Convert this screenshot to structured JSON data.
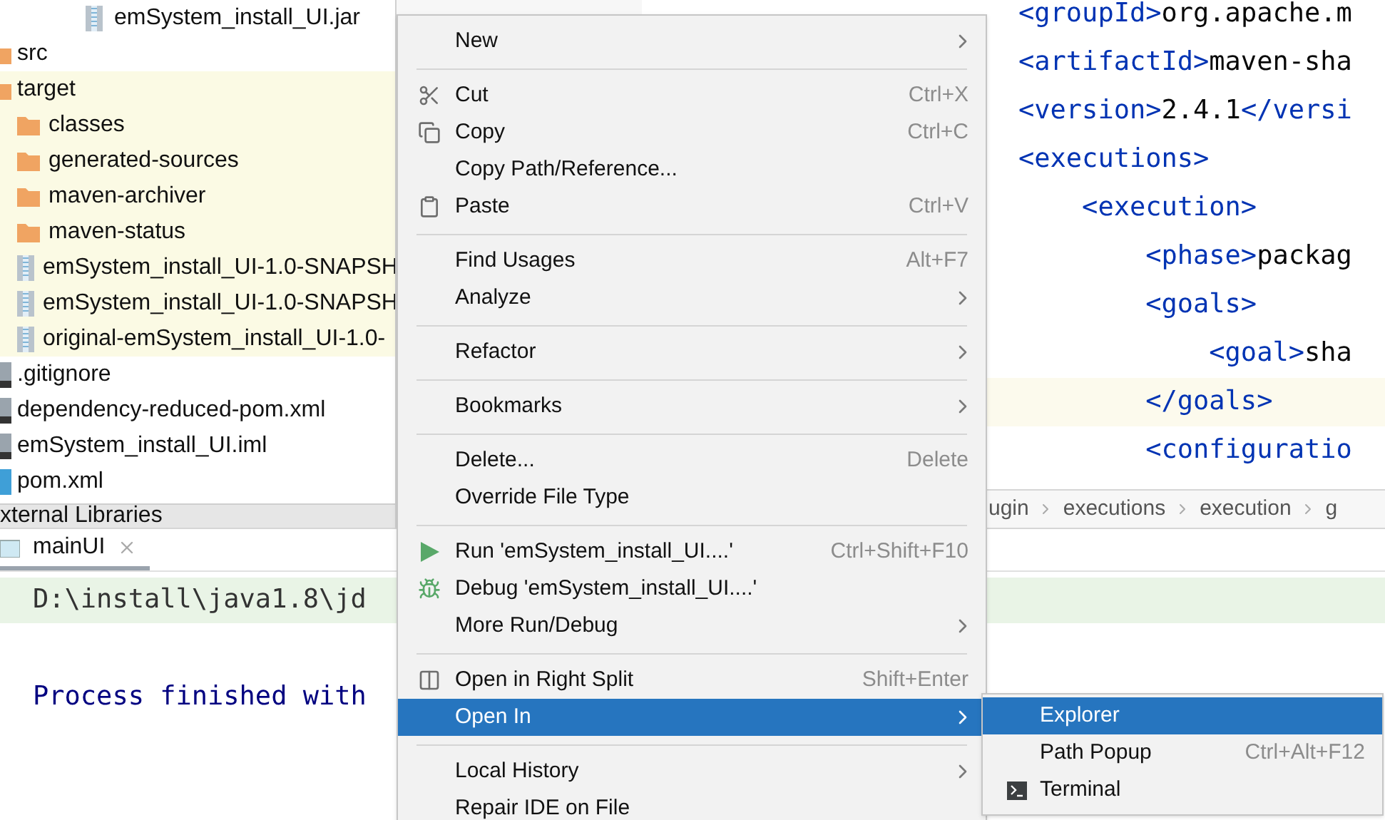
{
  "project_tree": {
    "header_item": {
      "label": "emSystem_install_UI.jar"
    },
    "items": [
      {
        "label": "src",
        "kind": "folder",
        "excluded": false
      },
      {
        "label": "target",
        "kind": "folder",
        "excluded": true,
        "children": [
          {
            "label": "classes",
            "kind": "folder",
            "excluded": true
          },
          {
            "label": "generated-sources",
            "kind": "folder",
            "excluded": true
          },
          {
            "label": "maven-archiver",
            "kind": "folder",
            "excluded": true
          },
          {
            "label": "maven-status",
            "kind": "folder",
            "excluded": true
          },
          {
            "label": "emSystem_install_UI-1.0-SNAPSH",
            "kind": "jar",
            "excluded": true
          },
          {
            "label": "emSystem_install_UI-1.0-SNAPSH",
            "kind": "jar",
            "excluded": true
          },
          {
            "label": "original-emSystem_install_UI-1.0-",
            "kind": "jar",
            "excluded": true
          }
        ]
      },
      {
        "label": ".gitignore",
        "kind": "file",
        "excluded": false
      },
      {
        "label": "dependency-reduced-pom.xml",
        "kind": "file",
        "excluded": false
      },
      {
        "label": "emSystem_install_UI.iml",
        "kind": "file",
        "excluded": false
      },
      {
        "label": "pom.xml",
        "kind": "maven",
        "excluded": false
      }
    ],
    "footer_item": {
      "label": "xternal Libraries"
    }
  },
  "editor": {
    "lines": [
      {
        "tag": "<groupId>",
        "text": "org.apache.m",
        "highlighted": false
      },
      {
        "tag": "<artifactId>",
        "text": "maven-sha",
        "highlighted": false
      },
      {
        "tag": "<version>",
        "text": "2.4.1",
        "end_tag": "</versi",
        "highlighted": false
      },
      {
        "tag": "<executions>",
        "highlighted": false
      },
      {
        "tag": "    <execution>",
        "highlighted": false
      },
      {
        "tag": "        <phase>",
        "text": "packag",
        "highlighted": false
      },
      {
        "tag": "        <goals>",
        "highlighted": false
      },
      {
        "tag": "            <goal>",
        "text": "sha",
        "highlighted": false
      },
      {
        "tag": "        </goals>",
        "highlighted": true
      },
      {
        "tag": "        <configuratio",
        "highlighted": false
      }
    ],
    "breadcrumbs": [
      "ugin",
      "executions",
      "execution",
      "g"
    ]
  },
  "run_panel": {
    "tab": {
      "label": "mainUI"
    },
    "console": [
      {
        "text": "D:\\install\\java1.8\\jd",
        "kind": "command"
      },
      {
        "kind": "blank"
      },
      {
        "text": "Process finished with",
        "kind": "message"
      }
    ]
  },
  "context_menu": {
    "items": [
      {
        "kind": "item",
        "label": "New",
        "submenu": true,
        "selected": false
      },
      {
        "kind": "separator"
      },
      {
        "kind": "item",
        "label": "Cut",
        "shortcut": "Ctrl+X",
        "submenu": false,
        "selected": false
      },
      {
        "kind": "item",
        "label": "Copy",
        "shortcut": "Ctrl+C",
        "submenu": false,
        "selected": false
      },
      {
        "kind": "item",
        "label": "Copy Path/Reference...",
        "submenu": false,
        "selected": false
      },
      {
        "kind": "item",
        "label": "Paste",
        "shortcut": "Ctrl+V",
        "submenu": false,
        "selected": false
      },
      {
        "kind": "separator"
      },
      {
        "kind": "item",
        "label": "Find Usages",
        "shortcut": "Alt+F7",
        "submenu": false,
        "selected": false
      },
      {
        "kind": "item",
        "label": "Analyze",
        "submenu": true,
        "selected": false
      },
      {
        "kind": "separator"
      },
      {
        "kind": "item",
        "label": "Refactor",
        "submenu": true,
        "selected": false
      },
      {
        "kind": "separator"
      },
      {
        "kind": "item",
        "label": "Bookmarks",
        "submenu": true,
        "selected": false
      },
      {
        "kind": "separator"
      },
      {
        "kind": "item",
        "label": "Delete...",
        "shortcut": "Delete",
        "submenu": false,
        "selected": false
      },
      {
        "kind": "item",
        "label": "Override File Type",
        "submenu": false,
        "selected": false
      },
      {
        "kind": "separator"
      },
      {
        "kind": "item",
        "label": "Run 'emSystem_install_UI....'",
        "shortcut": "Ctrl+Shift+F10",
        "submenu": false,
        "selected": false
      },
      {
        "kind": "item",
        "label": "Debug 'emSystem_install_UI....'",
        "submenu": false,
        "selected": false
      },
      {
        "kind": "item",
        "label": "More Run/Debug",
        "submenu": true,
        "selected": false
      },
      {
        "kind": "separator"
      },
      {
        "kind": "item",
        "label": "Open in Right Split",
        "shortcut": "Shift+Enter",
        "submenu": false,
        "selected": false
      },
      {
        "kind": "item",
        "label": "Open In",
        "submenu": true,
        "selected": true
      },
      {
        "kind": "separator"
      },
      {
        "kind": "item",
        "label": "Local History",
        "submenu": true,
        "selected": false
      },
      {
        "kind": "item",
        "label": "Repair IDE on File",
        "submenu": false,
        "selected": false
      }
    ]
  },
  "submenu": {
    "items": [
      {
        "label": "Explorer",
        "selected": true
      },
      {
        "label": "Path Popup",
        "shortcut": "Ctrl+Alt+F12",
        "selected": false
      },
      {
        "label": "Terminal",
        "selected": false
      }
    ]
  }
}
